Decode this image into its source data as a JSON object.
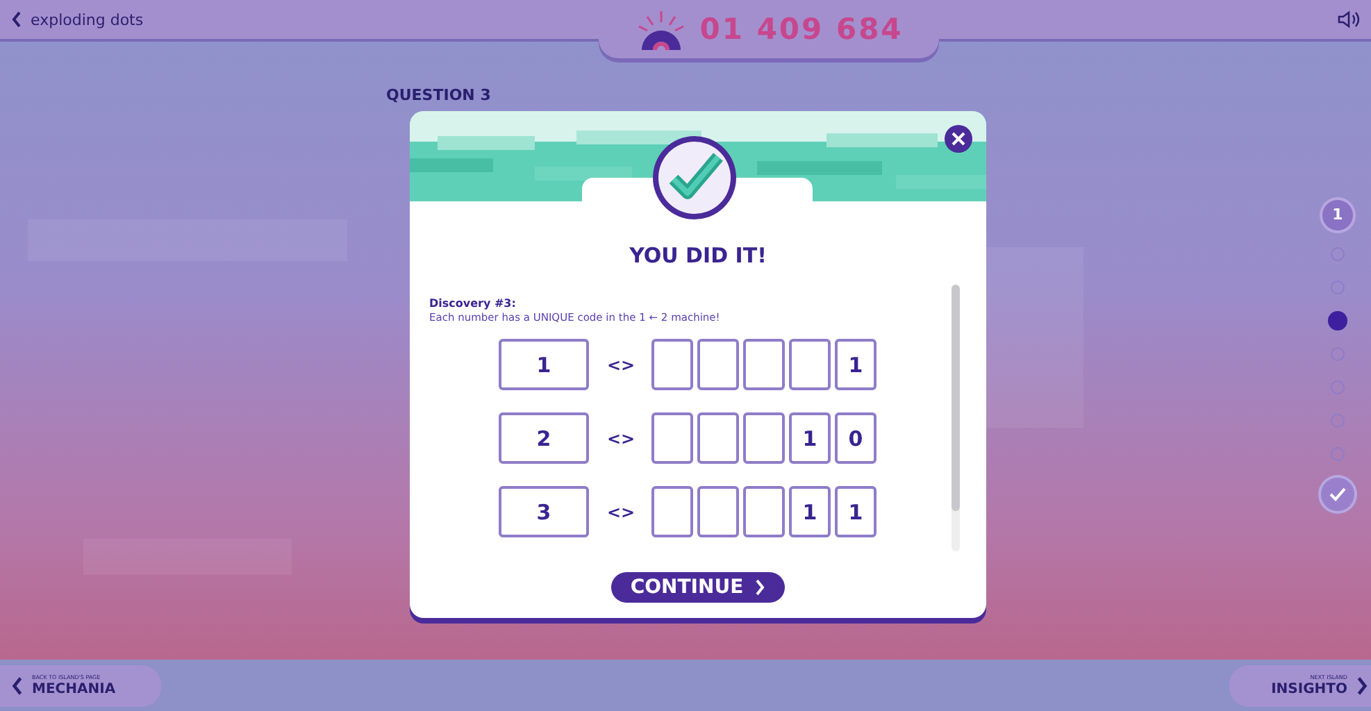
{
  "top_bar": {
    "back_label": "exploding dots",
    "score": "01 409 684"
  },
  "question_label": "QUESTION 3",
  "progress": [
    {
      "kind": "number",
      "label": "1",
      "selected": false
    },
    {
      "kind": "dot",
      "selected": false
    },
    {
      "kind": "dot",
      "selected": false
    },
    {
      "kind": "dot",
      "selected": true
    },
    {
      "kind": "dot",
      "selected": false
    },
    {
      "kind": "dot",
      "selected": false
    },
    {
      "kind": "dot",
      "selected": false
    },
    {
      "kind": "dot",
      "selected": false
    },
    {
      "kind": "check",
      "selected": false
    }
  ],
  "dialog": {
    "title": "YOU DID IT!",
    "heading": "Discovery #3:",
    "text": "Each number has a UNIQUE code in the 1 ← 2 machine!",
    "rows": [
      {
        "number": "1",
        "separator": "<>",
        "digits": [
          "1"
        ]
      },
      {
        "number": "2",
        "separator": "<>",
        "digits": [
          "1",
          "0"
        ]
      },
      {
        "number": "3",
        "separator": "<>",
        "digits": [
          "1",
          "1"
        ]
      }
    ],
    "continue_label": "CONTINUE"
  },
  "bottom_bar": {
    "back_caption": "BACK TO ISLAND'S PAGE",
    "back_label": "MECHANIA",
    "next_caption": "NEXT ISLAND",
    "next_label": "INSIGHTO"
  }
}
